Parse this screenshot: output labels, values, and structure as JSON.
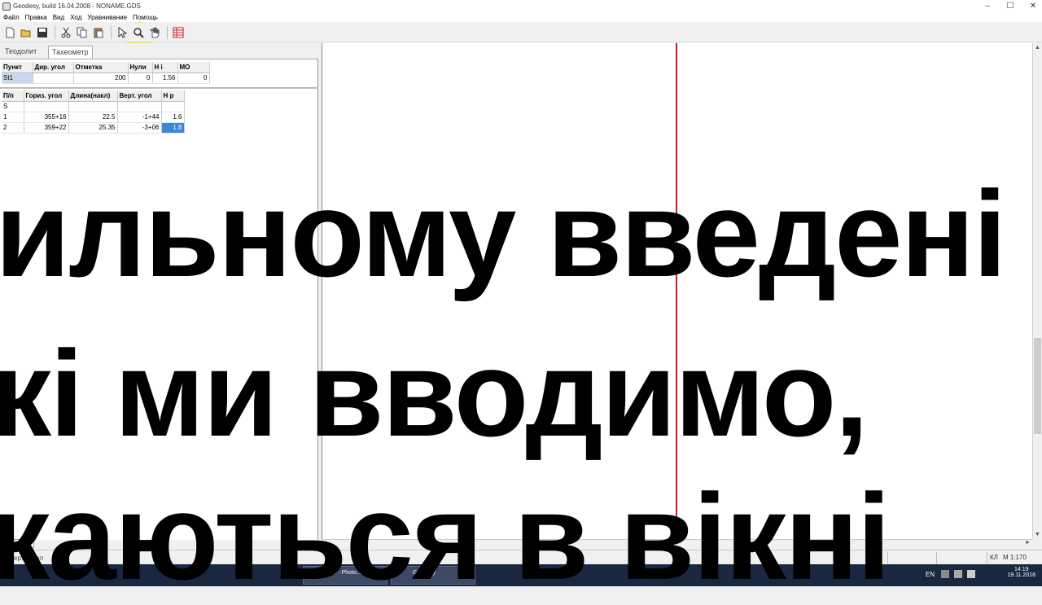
{
  "window": {
    "title": "Geodesy, build 16.04.2008 - NONAME.GDS"
  },
  "menu": [
    "Файл",
    "Правка",
    "Вид",
    "Ход",
    "Уравнивание",
    "Помощь"
  ],
  "toolbar": {
    "icons": [
      "new-file-icon",
      "open-folder-icon",
      "save-icon",
      "cut-icon",
      "copy-icon",
      "paste-icon",
      "pointer-icon",
      "zoom-icon",
      "hand-icon",
      "table-icon"
    ]
  },
  "tabs": [
    {
      "label": "Теодолит"
    },
    {
      "label": "Тахеометр",
      "active": true
    }
  ],
  "station_table": {
    "headers": [
      "Пункт",
      "Дир. угол",
      "Отметка",
      "Нули",
      "H i",
      "МО"
    ],
    "rows": [
      [
        "St1",
        "",
        "200",
        "0",
        "1.56",
        "0"
      ]
    ]
  },
  "obs_table": {
    "headers": [
      "П/п",
      "Гориз. угол",
      "Длина(накл)",
      "Верт. угол",
      "H p"
    ],
    "rows": [
      [
        "S",
        "",
        "",
        "",
        ""
      ],
      [
        "1",
        "355+16",
        "22.5",
        "-1+44",
        "1.6"
      ],
      [
        "2",
        "359+22",
        "25.35",
        "-3+06",
        "1.6"
      ]
    ]
  },
  "page_tab": "Лист 1",
  "status": {
    "left": "... верт... угол",
    "kl": "КЛ",
    "scale": "М 1:170"
  },
  "caption": {
    "line1": "ильному введені",
    "line2": "кі ми вводимо,",
    "line3": "каються в вікні"
  },
  "taskbar": {
    "tasks": [
      {
        "label": "Ер... - Photo..."
      },
      {
        "label": "Geodesy"
      }
    ],
    "lang": "EN",
    "time": "14:19",
    "date": "19.11.2018"
  },
  "colors": {
    "accent_line": "#d31818",
    "highlight_cell": "#3a86d8",
    "cursor_highlight": "#ffea00"
  }
}
